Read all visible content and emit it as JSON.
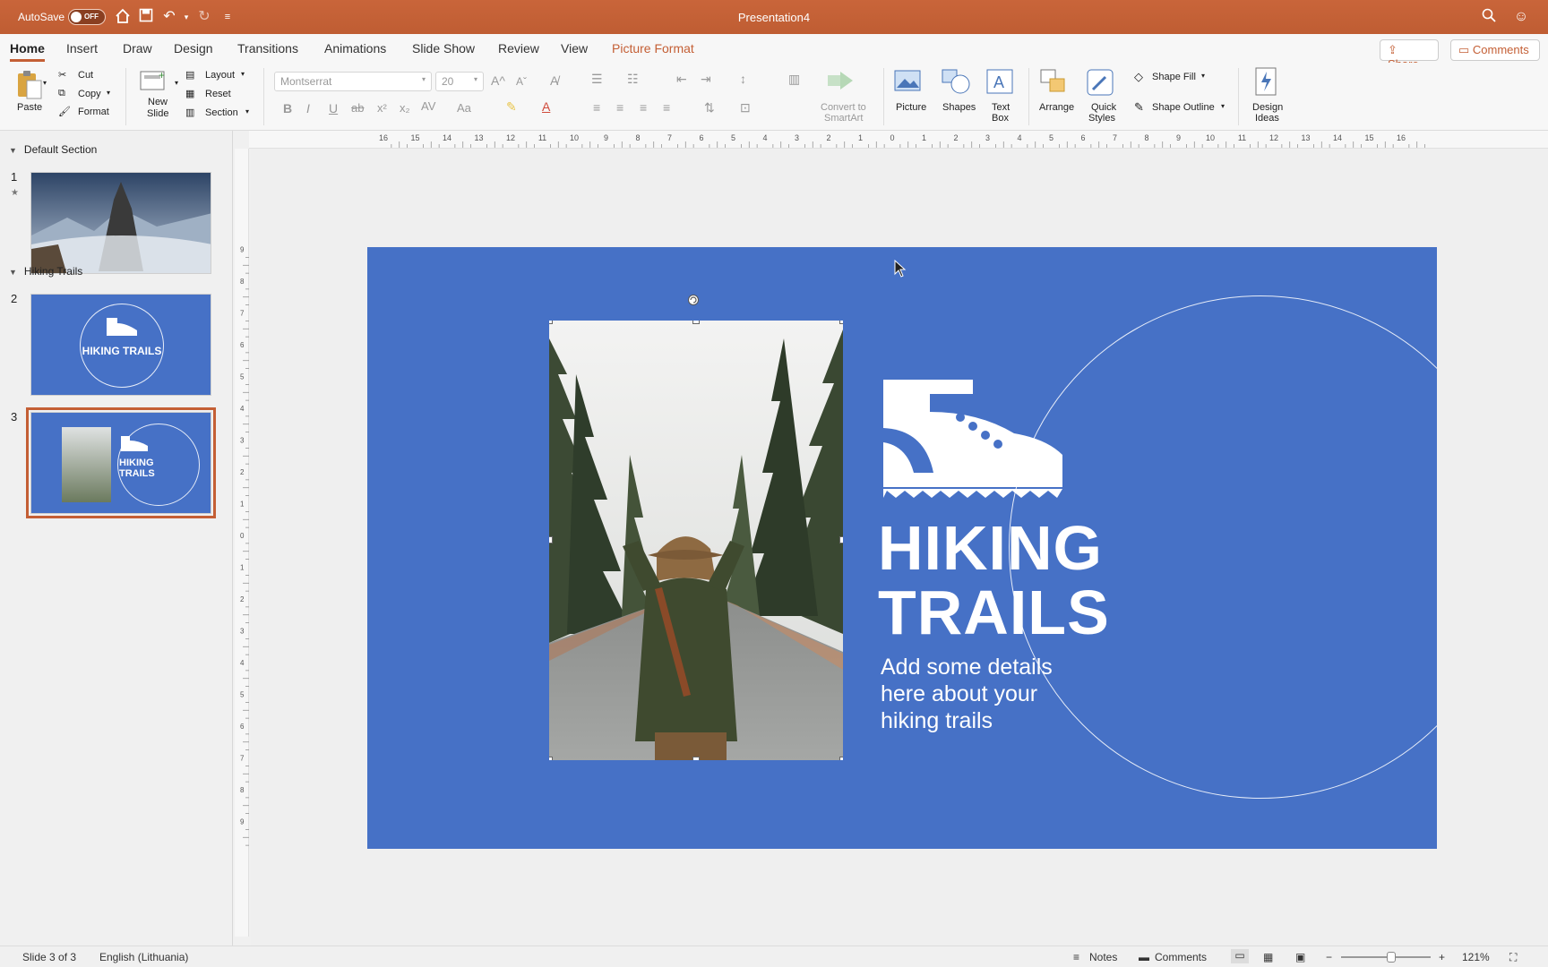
{
  "titlebar": {
    "autosave_label": "AutoSave",
    "autosave_state": "OFF",
    "title": "Presentation4",
    "bg_color": "#c45f35"
  },
  "tabs": [
    {
      "label": "Home",
      "active": true
    },
    {
      "label": "Insert"
    },
    {
      "label": "Draw"
    },
    {
      "label": "Design"
    },
    {
      "label": "Transitions"
    },
    {
      "label": "Animations"
    },
    {
      "label": "Slide Show"
    },
    {
      "label": "Review"
    },
    {
      "label": "View"
    },
    {
      "label": "Picture Format",
      "accent": true
    }
  ],
  "top_right": {
    "share": "Share",
    "comments": "Comments"
  },
  "ribbon": {
    "paste": "Paste",
    "cut": "Cut",
    "copy": "Copy",
    "format": "Format",
    "new_slide": [
      "New",
      "Slide"
    ],
    "layout": "Layout",
    "reset": "Reset",
    "section": "Section",
    "font_name": "Montserrat",
    "font_size": "20",
    "convert_smartart": [
      "Convert to",
      "SmartArt"
    ],
    "picture": "Picture",
    "shapes": "Shapes",
    "text_box": [
      "Text",
      "Box"
    ],
    "arrange": "Arrange",
    "quick_styles": [
      "Quick",
      "Styles"
    ],
    "shape_fill": "Shape Fill",
    "shape_outline": "Shape Outline",
    "design_ideas": [
      "Design",
      "Ideas"
    ]
  },
  "panel": {
    "section1": "Default Section",
    "section2": "Hiking Trails",
    "slides": [
      {
        "num": "1"
      },
      {
        "num": "2",
        "text": "HIKING TRAILS"
      },
      {
        "num": "3",
        "text": [
          "HIKING",
          "TRAILS"
        ],
        "selected": true
      }
    ]
  },
  "slide": {
    "title_line1": "HIKING",
    "title_line2": "TRAILS",
    "subtitle_line1": "Add some details",
    "subtitle_line2": "here about your",
    "subtitle_line3": "hiking trails",
    "bg_color": "#4671c6"
  },
  "statusbar": {
    "slide_info": "Slide 3 of 3",
    "language": "English (Lithuania)",
    "notes": "Notes",
    "comments": "Comments",
    "zoom": "121%"
  }
}
